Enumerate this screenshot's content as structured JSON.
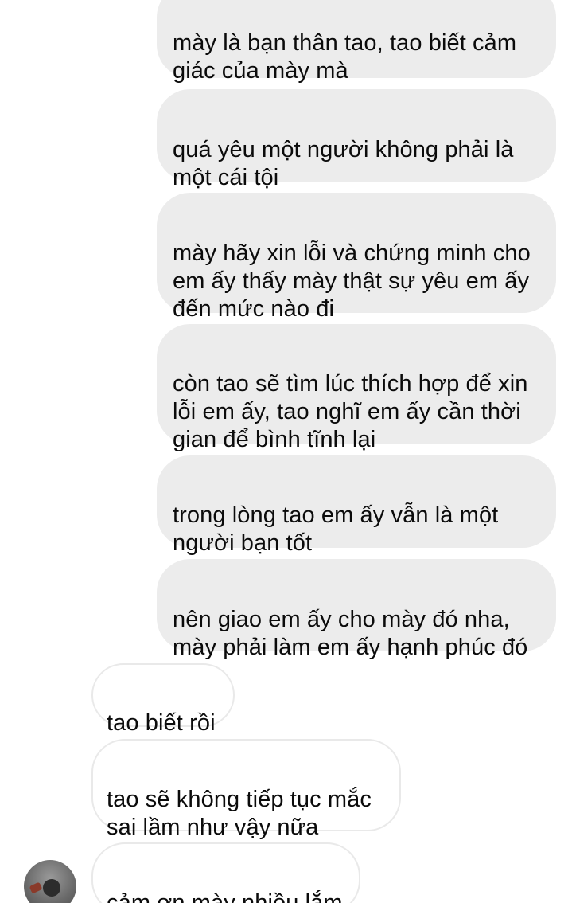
{
  "conversation": {
    "sent_messages": [
      "mày là bạn thân tao, tao biết cảm\ngiác của mày mà",
      "quá yêu một người không phải là\nmột cái tội",
      "mày hãy xin lỗi và chứng minh cho\nem ấy thấy mày thật sự yêu em ấy\nđến mức nào đi",
      "còn tao sẽ tìm lúc thích hợp để xin\nlỗi em ấy, tao nghĩ em ấy cần thời\ngian để bình tĩnh lại",
      "trong lòng tao em ấy vẫn là một\nngười bạn tốt",
      "nên giao em ấy cho mày đó nha,\nmày phải làm em ấy hạnh phúc đó"
    ],
    "received_messages": [
      "tao biết rồi",
      "tao sẽ không tiếp tục mắc\nsai lầm như vậy nữa",
      "cảm ơn mày nhiều lắm"
    ]
  },
  "colors": {
    "sent_bubble_bg": "#ececec",
    "received_bubble_border": "#e9e9e9",
    "text": "#0b0b0b",
    "background": "#ffffff"
  },
  "icons": {
    "avatar": "contact-avatar"
  }
}
